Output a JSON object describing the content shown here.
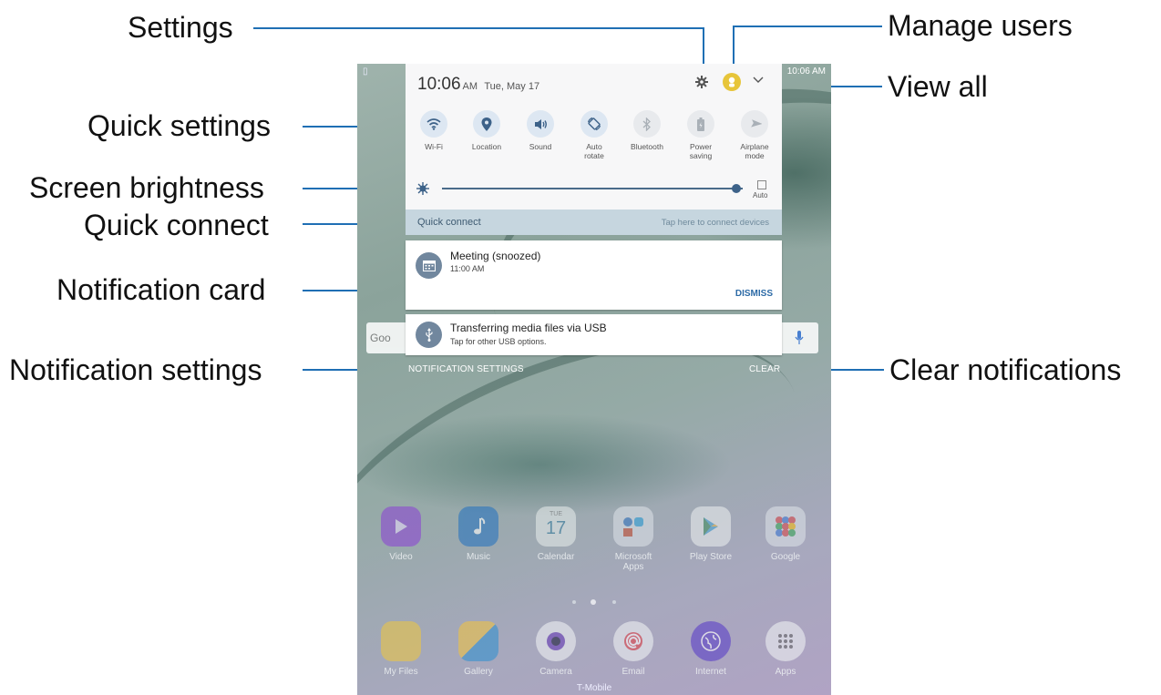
{
  "callouts": {
    "settings": "Settings",
    "manage_users": "Manage users",
    "view_all": "View all",
    "quick_settings": "Quick settings",
    "screen_brightness": "Screen brightness",
    "quick_connect": "Quick connect",
    "notification_card": "Notification card",
    "notification_settings": "Notification settings",
    "clear_notifications": "Clear notifications"
  },
  "status_bar": {
    "time": "10:06 AM"
  },
  "panel": {
    "time": "10:06",
    "ampm": "AM",
    "date": "Tue, May 17",
    "quick_settings": [
      {
        "label": "Wi-Fi",
        "icon": "wifi-icon",
        "on": true
      },
      {
        "label": "Location",
        "icon": "location-icon",
        "on": true
      },
      {
        "label": "Sound",
        "icon": "sound-icon",
        "on": true
      },
      {
        "label": "Auto\nrotate",
        "icon": "auto-rotate-icon",
        "on": true
      },
      {
        "label": "Bluetooth",
        "icon": "bluetooth-icon",
        "on": false
      },
      {
        "label": "Power\nsaving",
        "icon": "battery-icon",
        "on": false
      },
      {
        "label": "Airplane\nmode",
        "icon": "airplane-icon",
        "on": false
      }
    ],
    "brightness": {
      "level": 0.98,
      "auto_label": "Auto"
    }
  },
  "quick_connect": {
    "label": "Quick connect",
    "hint": "Tap here to connect devices"
  },
  "notifications": [
    {
      "title": "Meeting (snoozed)",
      "subtitle": "11:00 AM",
      "action": "DISMISS",
      "icon": "calendar-icon"
    },
    {
      "title": "Transferring media files via USB",
      "subtitle": "Tap for other USB options.",
      "icon": "usb-icon"
    }
  ],
  "footer": {
    "settings": "NOTIFICATION SETTINGS",
    "clear": "CLEAR"
  },
  "search_bar": {
    "text": "Goo"
  },
  "apps_row1": [
    "Video",
    "Music",
    "Calendar",
    "Microsoft Apps",
    "Play Store",
    "Google"
  ],
  "calendar_icon": {
    "day": "TUE",
    "date": "17"
  },
  "apps_row2": [
    "My Files",
    "Gallery",
    "Camera",
    "Email",
    "Internet",
    "Apps"
  ],
  "carrier": "T-Mobile",
  "colors": {
    "callout_line": "#1f6fb4",
    "accent": "#2c6aa6"
  }
}
